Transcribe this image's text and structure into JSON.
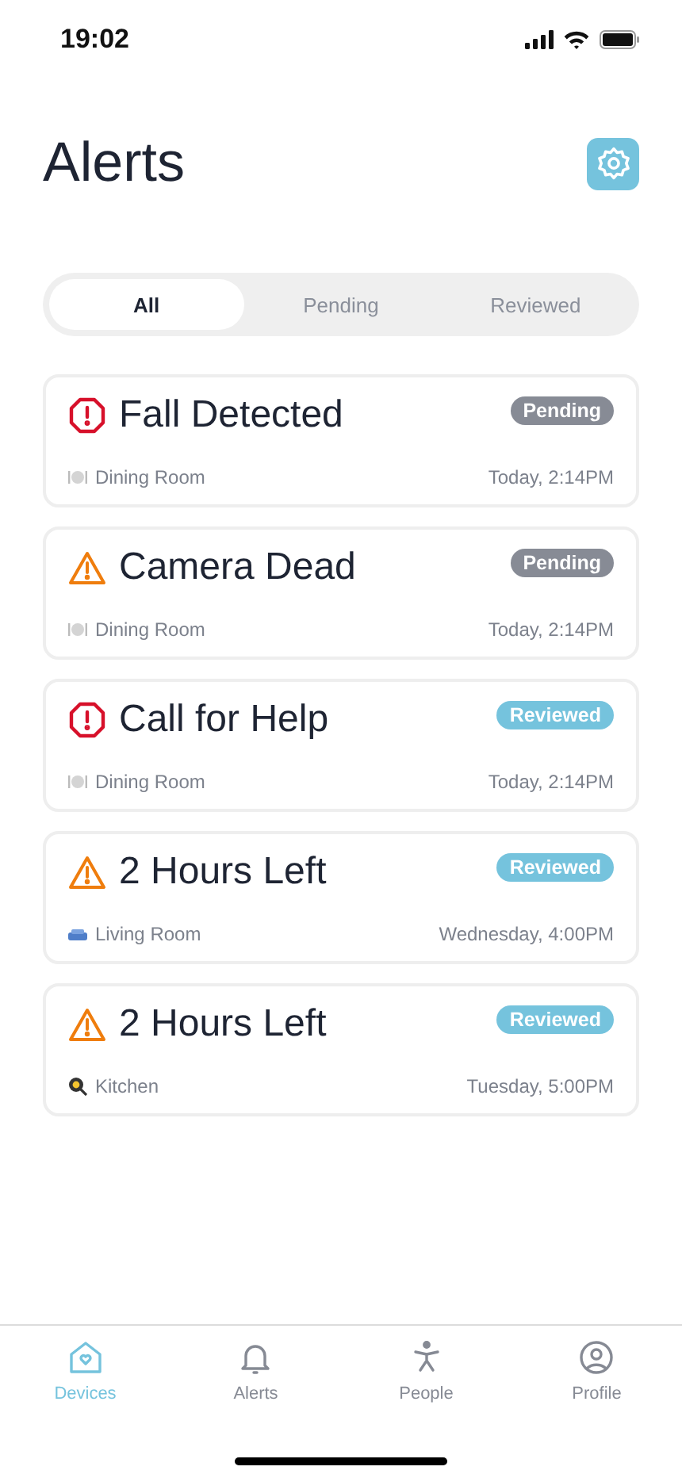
{
  "status_bar": {
    "time": "19:02"
  },
  "header": {
    "title": "Alerts"
  },
  "filter_tabs": [
    {
      "label": "All",
      "selected": true
    },
    {
      "label": "Pending",
      "selected": false
    },
    {
      "label": "Reviewed",
      "selected": false
    }
  ],
  "alerts": [
    {
      "kind": "critical",
      "title": "Fall Detected",
      "status": "Pending",
      "reviewed": false,
      "location": {
        "kind": "dining",
        "name": "Dining Room"
      },
      "time": "Today, 2:14PM"
    },
    {
      "kind": "warning",
      "title": "Camera Dead",
      "status": "Pending",
      "reviewed": false,
      "location": {
        "kind": "dining",
        "name": "Dining Room"
      },
      "time": "Today, 2:14PM"
    },
    {
      "kind": "critical",
      "title": "Call for Help",
      "status": "Reviewed",
      "reviewed": true,
      "location": {
        "kind": "dining",
        "name": "Dining Room"
      },
      "time": "Today, 2:14PM"
    },
    {
      "kind": "warning",
      "title": "2 Hours Left",
      "status": "Reviewed",
      "reviewed": true,
      "location": {
        "kind": "living",
        "name": "Living Room"
      },
      "time": "Wednesday, 4:00PM"
    },
    {
      "kind": "warning",
      "title": "2 Hours Left",
      "status": "Reviewed",
      "reviewed": true,
      "location": {
        "kind": "kitchen",
        "name": "Kitchen"
      },
      "time": "Tuesday, 5:00PM"
    }
  ],
  "tab_bar": [
    {
      "kind": "devices",
      "label": "Devices",
      "selected": true
    },
    {
      "kind": "alerts",
      "label": "Alerts",
      "selected": false
    },
    {
      "kind": "people",
      "label": "People",
      "selected": false
    },
    {
      "kind": "profile",
      "label": "Profile",
      "selected": false
    }
  ]
}
